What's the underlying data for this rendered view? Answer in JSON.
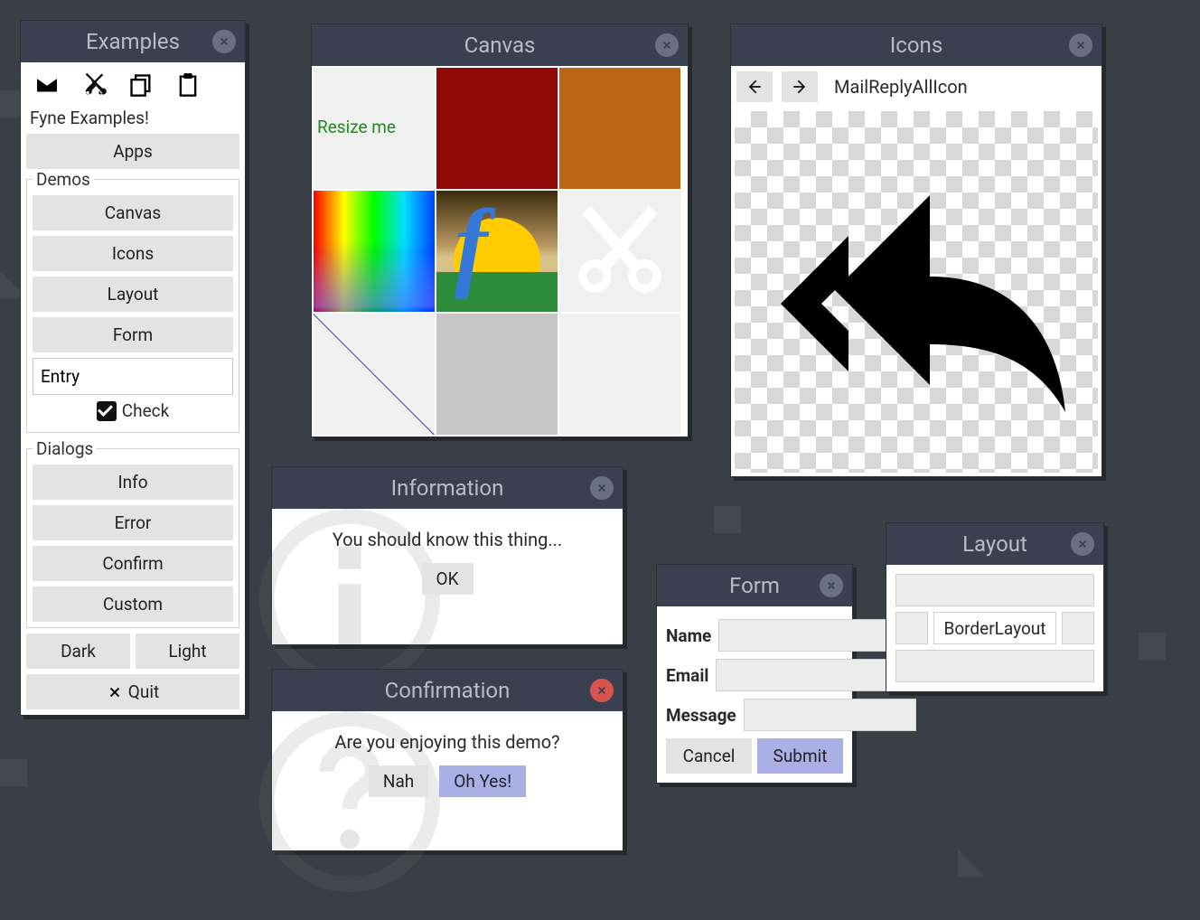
{
  "examples": {
    "title": "Examples",
    "heading": "Fyne Examples!",
    "apps_btn": "Apps",
    "demos_label": "Demos",
    "demo_buttons": [
      "Canvas",
      "Icons",
      "Layout",
      "Form"
    ],
    "entry_value": "Entry",
    "check_label": "Check",
    "dialogs_label": "Dialogs",
    "dialog_buttons": [
      "Info",
      "Error",
      "Confirm",
      "Custom"
    ],
    "dark_btn": "Dark",
    "light_btn": "Light",
    "quit_btn": "Quit"
  },
  "canvas": {
    "title": "Canvas",
    "resize_text": "Resize me",
    "resize_color": "#1e8a1e"
  },
  "icons": {
    "title": "Icons",
    "icon_name": "MailReplyAllIcon"
  },
  "information": {
    "title": "Information",
    "message": "You should know this thing...",
    "ok_btn": "OK"
  },
  "confirmation": {
    "title": "Confirmation",
    "message": "Are you enjoying this demo?",
    "no_btn": "Nah",
    "yes_btn": "Oh Yes!"
  },
  "form": {
    "title": "Form",
    "fields": {
      "name": "Name",
      "email": "Email",
      "message": "Message"
    },
    "cancel_btn": "Cancel",
    "submit_btn": "Submit"
  },
  "layout": {
    "title": "Layout",
    "center_text": "BorderLayout"
  }
}
